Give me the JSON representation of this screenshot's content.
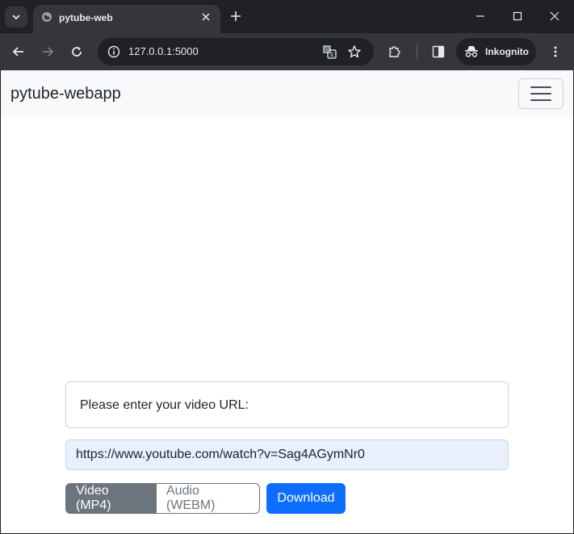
{
  "browser": {
    "tab": {
      "title": "pytube-web",
      "favicon": "globe-icon"
    },
    "omnibox": {
      "url": "127.0.0.1:5000"
    },
    "profile": {
      "label": "Inkognito"
    }
  },
  "app": {
    "brand": "pytube-webapp",
    "prompt": "Please enter your video URL:",
    "url_input": {
      "value": "https://www.youtube.com/watch?v=Sag4AGymNr0"
    },
    "formats": [
      {
        "label": "Video (MP4)",
        "selected": true
      },
      {
        "label": "Audio (WEBM)",
        "selected": false
      }
    ],
    "download_label": "Download"
  },
  "colors": {
    "primary": "#0d6efd",
    "secondary": "#6c757d",
    "navbar_bg": "#f8f9fa",
    "autofill_bg": "#e8f0fe"
  }
}
